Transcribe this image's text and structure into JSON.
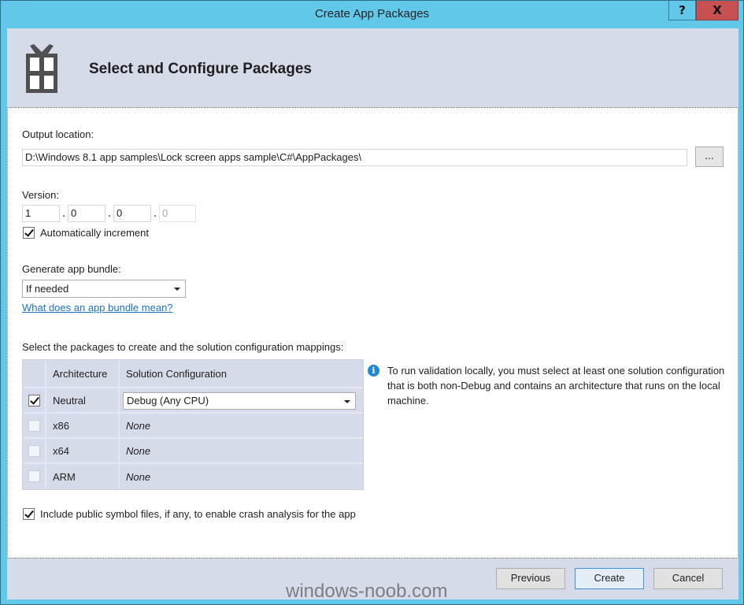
{
  "window": {
    "title": "Create App Packages",
    "help_label": "?",
    "close_label": "X"
  },
  "header": {
    "title": "Select and Configure Packages",
    "icon": "package-gift-icon"
  },
  "output_location": {
    "label": "Output location:",
    "value": "D:\\Windows 8.1 app samples\\Lock screen apps sample\\C#\\AppPackages\\",
    "browse_label": "..."
  },
  "version": {
    "label": "Version:",
    "major": "1",
    "minor": "0",
    "build": "0",
    "revision": "0",
    "separator": ".",
    "auto_increment_label": "Automatically increment",
    "auto_increment_checked": true
  },
  "bundle": {
    "label": "Generate app bundle:",
    "selected": "If needed",
    "help_link": "What does an app bundle mean?"
  },
  "packages": {
    "label": "Select the packages to create and the solution configuration mappings:",
    "columns": [
      "",
      "Architecture",
      "Solution Configuration"
    ],
    "rows": [
      {
        "checked": true,
        "architecture": "Neutral",
        "configuration": "Debug (Any CPU)",
        "editable": true
      },
      {
        "checked": false,
        "architecture": "x86",
        "configuration": "None",
        "editable": false
      },
      {
        "checked": false,
        "architecture": "x64",
        "configuration": "None",
        "editable": false
      },
      {
        "checked": false,
        "architecture": "ARM",
        "configuration": "None",
        "editable": false
      }
    ]
  },
  "info": {
    "icon": "info-icon",
    "text": "To run validation locally, you must select at least one solution configuration that is both non-Debug and contains an architecture that runs on the local machine."
  },
  "symbols": {
    "label": "Include public symbol files, if any, to enable crash analysis for the app",
    "checked": true
  },
  "footer": {
    "previous_label": "Previous",
    "create_label": "Create",
    "cancel_label": "Cancel"
  },
  "watermark": "windows-noob.com"
}
